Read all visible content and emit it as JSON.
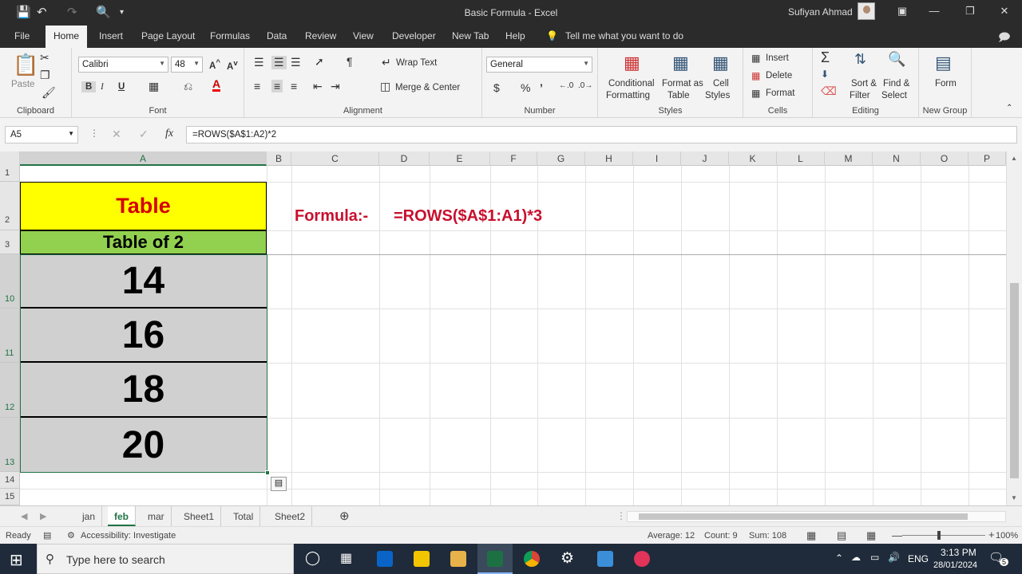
{
  "window": {
    "title": "Basic Formula  -  Excel",
    "user": "Sufiyan Ahmad"
  },
  "menu": {
    "tabs": [
      "File",
      "Home",
      "Insert",
      "Page Layout",
      "Formulas",
      "Data",
      "Review",
      "View",
      "Developer",
      "New Tab",
      "Help"
    ],
    "active": "Home",
    "tell_me": "Tell me what you want to do"
  },
  "ribbon": {
    "clipboard": {
      "paste": "Paste",
      "label": "Clipboard"
    },
    "font": {
      "name": "Calibri",
      "size": "48",
      "label": "Font",
      "bold": "B",
      "italic": "I",
      "underline": "U"
    },
    "alignment": {
      "wrap_text": "Wrap Text",
      "merge_center": "Merge & Center",
      "label": "Alignment"
    },
    "number": {
      "format": "General",
      "label": "Number",
      "currency": "$",
      "percent": "%",
      "comma": "’"
    },
    "styles": {
      "conditional": [
        "Conditional",
        "Formatting"
      ],
      "format_as_table": [
        "Format as",
        "Table"
      ],
      "cell_styles": [
        "Cell",
        "Styles"
      ],
      "label": "Styles"
    },
    "cells": {
      "insert": "Insert",
      "delete": "Delete",
      "format": "Format",
      "label": "Cells"
    },
    "editing": {
      "sort_filter": [
        "Sort &",
        "Filter"
      ],
      "find_select": [
        "Find &",
        "Select"
      ],
      "label": "Editing"
    },
    "new_group": {
      "form": "Form",
      "label": "New Group"
    }
  },
  "formula_bar": {
    "name_box": "A5",
    "formula": "=ROWS($A$1:A2)*2"
  },
  "columns": [
    "A",
    "B",
    "C",
    "D",
    "E",
    "F",
    "G",
    "H",
    "I",
    "J",
    "K",
    "L",
    "M",
    "N",
    "O",
    "P"
  ],
  "rows": [
    "1",
    "2",
    "3",
    "10",
    "11",
    "12",
    "13",
    "14",
    "15"
  ],
  "cells": {
    "a2": "Table",
    "a3": "Table of 2",
    "a10": "14",
    "a11": "16",
    "a12": "18",
    "a13": "20",
    "formula_label": "Formula:-",
    "formula_text": "=ROWS($A$1:A1)*3"
  },
  "colors": {
    "title_fill": "#ffff00",
    "title_text": "#d40000",
    "subtitle_fill": "#92d050",
    "selection_fill": "#d0d0d0",
    "formula_text": "#c8102e",
    "accent": "#217346"
  },
  "sheets": {
    "tabs": [
      "jan",
      "feb",
      "mar",
      "Sheet1",
      "Total",
      "Sheet2"
    ],
    "active": "feb"
  },
  "status": {
    "ready": "Ready",
    "accessibility": "Accessibility: Investigate",
    "average": "Average: 12",
    "count": "Count: 9",
    "sum": "Sum: 108",
    "zoom": "100%"
  },
  "taskbar": {
    "search_placeholder": "Type here to search",
    "lang": "ENG",
    "time": "3:13 PM",
    "date": "28/01/2024",
    "notifications": "5"
  }
}
